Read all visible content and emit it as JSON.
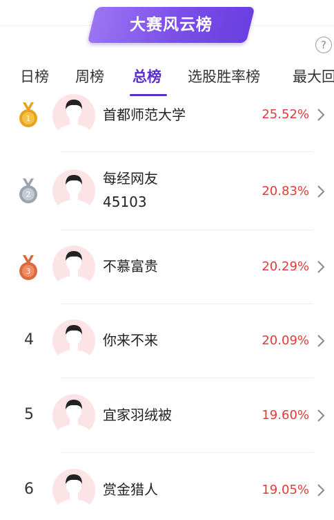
{
  "banner": {
    "title": "大赛风云榜"
  },
  "help_label": "?",
  "tabs": [
    {
      "label": "日榜"
    },
    {
      "label": "周榜"
    },
    {
      "label": "总榜"
    },
    {
      "label": "选股胜率榜"
    },
    {
      "label": "最大回"
    }
  ],
  "active_tab": "总榜",
  "colors": {
    "accent": "#5b2ed0",
    "rate": "#e03a3a",
    "gold": "#e9a21e",
    "silver": "#9aa3ae",
    "bronze": "#d96a3f",
    "avatar_bg": "#fce4e6"
  },
  "rankings": [
    {
      "rank": "1",
      "medal": "gold-medal-icon",
      "name": "首都师范大学",
      "name_line2": "",
      "rate": "25.52%"
    },
    {
      "rank": "2",
      "medal": "silver-medal-icon",
      "name": "每经网友",
      "name_line2": "45103",
      "rate": "20.83%"
    },
    {
      "rank": "3",
      "medal": "bronze-medal-icon",
      "name": "不慕富贵",
      "name_line2": "",
      "rate": "20.29%"
    },
    {
      "rank": "4",
      "medal": "",
      "name": "你来不来",
      "name_line2": "",
      "rate": "20.09%"
    },
    {
      "rank": "5",
      "medal": "",
      "name": "宜家羽绒被",
      "name_line2": "",
      "rate": "19.60%"
    },
    {
      "rank": "6",
      "medal": "",
      "name": "赏金猎人",
      "name_line2": "",
      "rate": "19.05%"
    }
  ]
}
